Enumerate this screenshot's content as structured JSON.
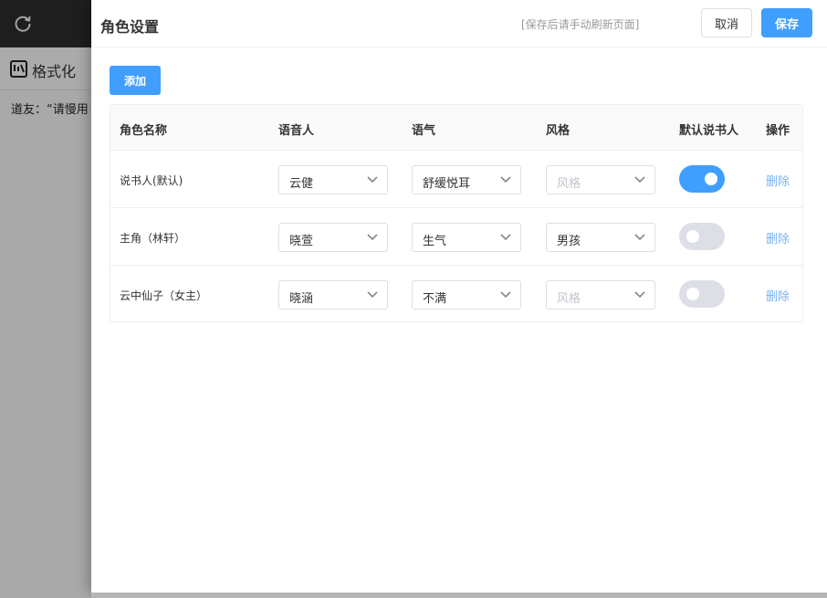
{
  "background": {
    "refresh_icon": "refresh-icon",
    "format_label": "格式化",
    "format_icon": "format-icon",
    "doc_text": "道友：“请慢用"
  },
  "drawer": {
    "title": "角色设置",
    "hint": "[保存后请手动刷新页面]",
    "cancel_label": "取消",
    "save_label": "保存",
    "add_label": "添加"
  },
  "table": {
    "headers": {
      "name": "角色名称",
      "voice": "语音人",
      "tone": "语气",
      "style": "风格",
      "default_narrator": "默认说书人",
      "actions": "操作"
    },
    "rows": [
      {
        "name": "说书人(默认)",
        "voice": "云健",
        "tone": "舒缓悦耳",
        "style": "",
        "style_placeholder": "风格",
        "default_narrator": true,
        "delete_label": "删除"
      },
      {
        "name": "主角（林轩）",
        "voice": "晓萱",
        "tone": "生气",
        "style": "男孩",
        "style_placeholder": "风格",
        "default_narrator": false,
        "delete_label": "删除"
      },
      {
        "name": "云中仙子（女主）",
        "voice": "晓涵",
        "tone": "不满",
        "style": "",
        "style_placeholder": "风格",
        "default_narrator": false,
        "delete_label": "删除"
      }
    ]
  },
  "colors": {
    "primary": "#409eff",
    "link": "#79b3f2",
    "switch_off": "#dcdfe6",
    "topbar": "#2b2b2b"
  }
}
